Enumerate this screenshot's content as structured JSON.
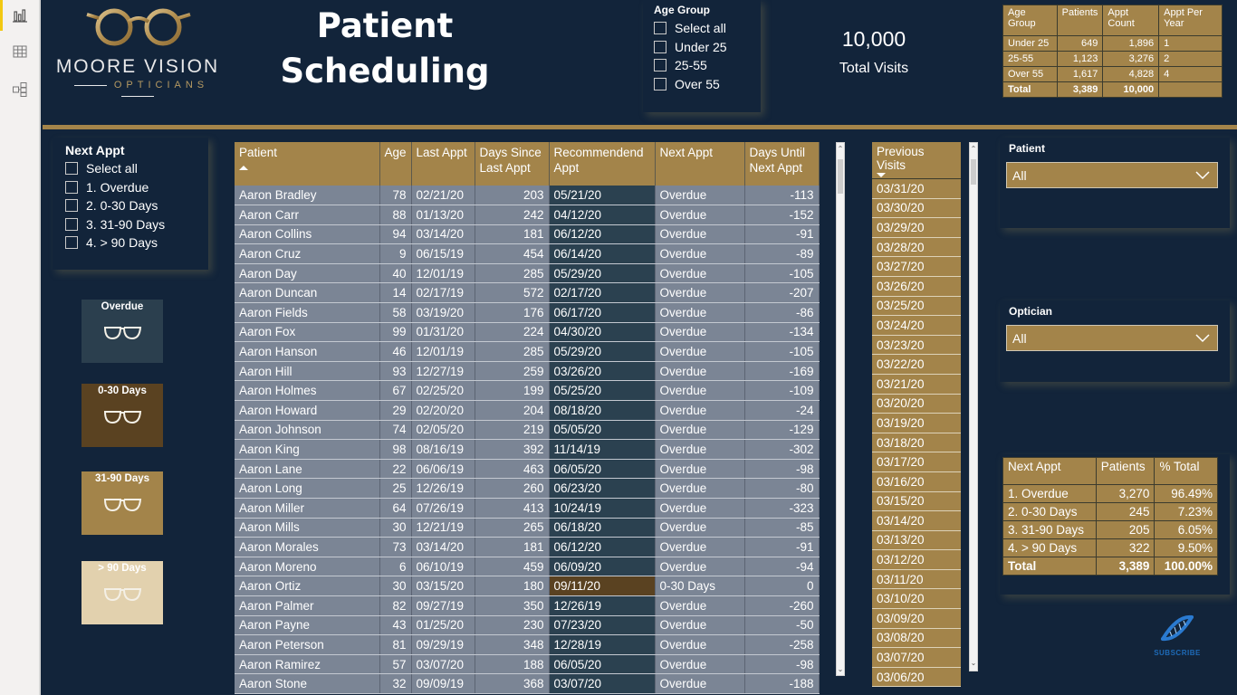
{
  "rail": {
    "items": [
      {
        "name": "report-view",
        "icon": "bar-chart-icon",
        "active": true
      },
      {
        "name": "data-view",
        "icon": "table-grid-icon",
        "active": false
      },
      {
        "name": "model-view",
        "icon": "model-icon",
        "active": false
      }
    ]
  },
  "header": {
    "logo": {
      "brand": "MOORE VISION",
      "sub": "OPTICIANS",
      "icon": "glasses-icon"
    },
    "title_line1": "Patient",
    "title_line2": "Scheduling"
  },
  "age_group_slicer": {
    "title": "Age Group",
    "options": [
      "Select all",
      "Under 25",
      "25-55",
      "Over 55"
    ]
  },
  "kpi": {
    "value": "10,000",
    "label": "Total Visits"
  },
  "age_table": {
    "headers": [
      "Age Group",
      "Patients",
      "Appt Count",
      "Appt Per Year"
    ],
    "rows": [
      [
        "Under 25",
        "649",
        "1,896",
        "1"
      ],
      [
        "25-55",
        "1,123",
        "3,276",
        "2"
      ],
      [
        "Over 55",
        "1,617",
        "4,828",
        "4"
      ]
    ],
    "total": [
      "Total",
      "3,389",
      "10,000",
      ""
    ]
  },
  "next_appt_slicer": {
    "title": "Next Appt",
    "options": [
      "Select all",
      "1. Overdue",
      "2. 0-30 Days",
      "3. 31-90 Days",
      "4. > 90 Days"
    ]
  },
  "legend_tiles": [
    {
      "label": "Overdue",
      "color": "#2b3f4e"
    },
    {
      "label": "0-30 Days",
      "color": "#5a4221"
    },
    {
      "label": "31-90 Days",
      "color": "#a3844a"
    },
    {
      "label": "> 90 Days",
      "color": "#e2d1ae"
    }
  ],
  "patient_table": {
    "headers": [
      "Patient",
      "Age",
      "Last Appt",
      "Days Since Last Appt",
      "Recommendend Appt",
      "Next Appt",
      "Days Until Next Appt"
    ],
    "sort_column": "Patient",
    "sort_direction": "ascending",
    "rows": [
      [
        "Aaron Bradley",
        "78",
        "02/21/20",
        "203",
        "05/21/20",
        "Overdue",
        "-113"
      ],
      [
        "Aaron Carr",
        "88",
        "01/13/20",
        "242",
        "04/12/20",
        "Overdue",
        "-152"
      ],
      [
        "Aaron Collins",
        "94",
        "03/14/20",
        "181",
        "06/12/20",
        "Overdue",
        "-91"
      ],
      [
        "Aaron Cruz",
        "9",
        "06/15/19",
        "454",
        "06/14/20",
        "Overdue",
        "-89"
      ],
      [
        "Aaron Day",
        "40",
        "12/01/19",
        "285",
        "05/29/20",
        "Overdue",
        "-105"
      ],
      [
        "Aaron Duncan",
        "14",
        "02/17/19",
        "572",
        "02/17/20",
        "Overdue",
        "-207"
      ],
      [
        "Aaron Fields",
        "58",
        "03/19/20",
        "176",
        "06/17/20",
        "Overdue",
        "-86"
      ],
      [
        "Aaron Fox",
        "99",
        "01/31/20",
        "224",
        "04/30/20",
        "Overdue",
        "-134"
      ],
      [
        "Aaron Hanson",
        "46",
        "12/01/19",
        "285",
        "05/29/20",
        "Overdue",
        "-105"
      ],
      [
        "Aaron Hill",
        "93",
        "12/27/19",
        "259",
        "03/26/20",
        "Overdue",
        "-169"
      ],
      [
        "Aaron Holmes",
        "67",
        "02/25/20",
        "199",
        "05/25/20",
        "Overdue",
        "-109"
      ],
      [
        "Aaron Howard",
        "29",
        "02/20/20",
        "204",
        "08/18/20",
        "Overdue",
        "-24"
      ],
      [
        "Aaron Johnson",
        "74",
        "02/05/20",
        "219",
        "05/05/20",
        "Overdue",
        "-129"
      ],
      [
        "Aaron King",
        "98",
        "08/16/19",
        "392",
        "11/14/19",
        "Overdue",
        "-302"
      ],
      [
        "Aaron Lane",
        "22",
        "06/06/19",
        "463",
        "06/05/20",
        "Overdue",
        "-98"
      ],
      [
        "Aaron Long",
        "25",
        "12/26/19",
        "260",
        "06/23/20",
        "Overdue",
        "-80"
      ],
      [
        "Aaron Miller",
        "64",
        "07/26/19",
        "413",
        "10/24/19",
        "Overdue",
        "-323"
      ],
      [
        "Aaron Mills",
        "30",
        "12/21/19",
        "265",
        "06/18/20",
        "Overdue",
        "-85"
      ],
      [
        "Aaron Morales",
        "73",
        "03/14/20",
        "181",
        "06/12/20",
        "Overdue",
        "-91"
      ],
      [
        "Aaron Moreno",
        "6",
        "06/10/19",
        "459",
        "06/09/20",
        "Overdue",
        "-94"
      ],
      [
        "Aaron Ortiz",
        "30",
        "03/15/20",
        "180",
        "09/11/20",
        "0-30 Days",
        "0"
      ],
      [
        "Aaron Palmer",
        "82",
        "09/27/19",
        "350",
        "12/26/19",
        "Overdue",
        "-260"
      ],
      [
        "Aaron Payne",
        "43",
        "01/25/20",
        "230",
        "07/23/20",
        "Overdue",
        "-50"
      ],
      [
        "Aaron Peterson",
        "81",
        "09/29/19",
        "348",
        "12/28/19",
        "Overdue",
        "-258"
      ],
      [
        "Aaron Ramirez",
        "57",
        "03/07/20",
        "188",
        "06/05/20",
        "Overdue",
        "-98"
      ],
      [
        "Aaron Stone",
        "32",
        "09/09/19",
        "368",
        "03/07/20",
        "Overdue",
        "-188"
      ]
    ]
  },
  "previous_visits": {
    "header": "Previous Visits",
    "sort_direction": "descending",
    "dates": [
      "03/31/20",
      "03/30/20",
      "03/29/20",
      "03/28/20",
      "03/27/20",
      "03/26/20",
      "03/25/20",
      "03/24/20",
      "03/23/20",
      "03/22/20",
      "03/21/20",
      "03/20/20",
      "03/19/20",
      "03/18/20",
      "03/17/20",
      "03/16/20",
      "03/15/20",
      "03/14/20",
      "03/13/20",
      "03/12/20",
      "03/11/20",
      "03/10/20",
      "03/09/20",
      "03/08/20",
      "03/07/20",
      "03/06/20"
    ]
  },
  "patient_dropdown": {
    "label": "Patient",
    "value": "All"
  },
  "optician_dropdown": {
    "label": "Optician",
    "value": "All"
  },
  "next_appt_table": {
    "headers": [
      "Next Appt",
      "Patients",
      "% Total"
    ],
    "rows": [
      [
        "1. Overdue",
        "3,270",
        "96.49%"
      ],
      [
        "2. 0-30 Days",
        "245",
        "7.23%"
      ],
      [
        "3. 31-90 Days",
        "205",
        "6.05%"
      ],
      [
        "4. > 90 Days",
        "322",
        "9.50%"
      ]
    ],
    "total": [
      "Total",
      "3,389",
      "100.00%"
    ]
  },
  "subscribe": {
    "label": "SUBSCRIBE",
    "icon": "dna-icon"
  },
  "colors": {
    "background": "#12243a",
    "gold": "#a3844a",
    "row_grey": "#7b8595",
    "overdue": "#2b4150",
    "soon": "#5a4221"
  }
}
